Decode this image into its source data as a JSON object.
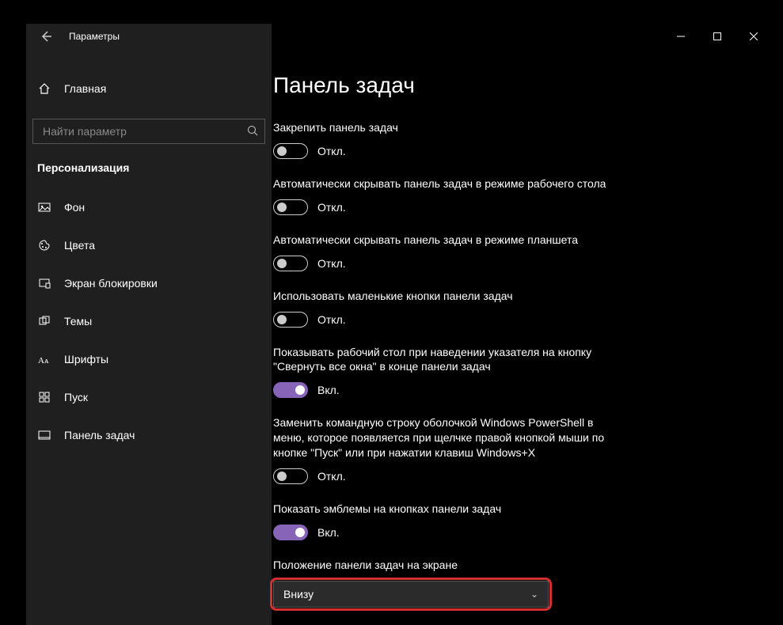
{
  "titlebar": {
    "app_title": "Параметры"
  },
  "sidebar": {
    "home": "Главная",
    "search_placeholder": "Найти параметр",
    "section": "Персонализация",
    "items": [
      {
        "label": "Фон"
      },
      {
        "label": "Цвета"
      },
      {
        "label": "Экран блокировки"
      },
      {
        "label": "Темы"
      },
      {
        "label": "Шрифты"
      },
      {
        "label": "Пуск"
      },
      {
        "label": "Панель задач"
      }
    ]
  },
  "main": {
    "title": "Панель задач",
    "settings": [
      {
        "label": "Закрепить панель задач",
        "on": false
      },
      {
        "label": "Автоматически скрывать панель задач в режиме рабочего стола",
        "on": false
      },
      {
        "label": "Автоматически скрывать панель задач в режиме планшета",
        "on": false
      },
      {
        "label": "Использовать маленькие кнопки панели задач",
        "on": false
      },
      {
        "label": "Показывать рабочий стол при наведении указателя на кнопку \"Свернуть все окна\" в конце панели задач",
        "on": true
      },
      {
        "label": "Заменить командную строку оболочкой Windows PowerShell в меню, которое появляется при щелчке правой кнопкой мыши по кнопке \"Пуск\" или при нажатии клавиш Windows+X",
        "on": false
      },
      {
        "label": "Показать эмблемы на кнопках панели задач",
        "on": true
      }
    ],
    "on_text": "Вкл.",
    "off_text": "Откл.",
    "position_label": "Положение панели задач на экране",
    "position_value": "Внизу"
  }
}
